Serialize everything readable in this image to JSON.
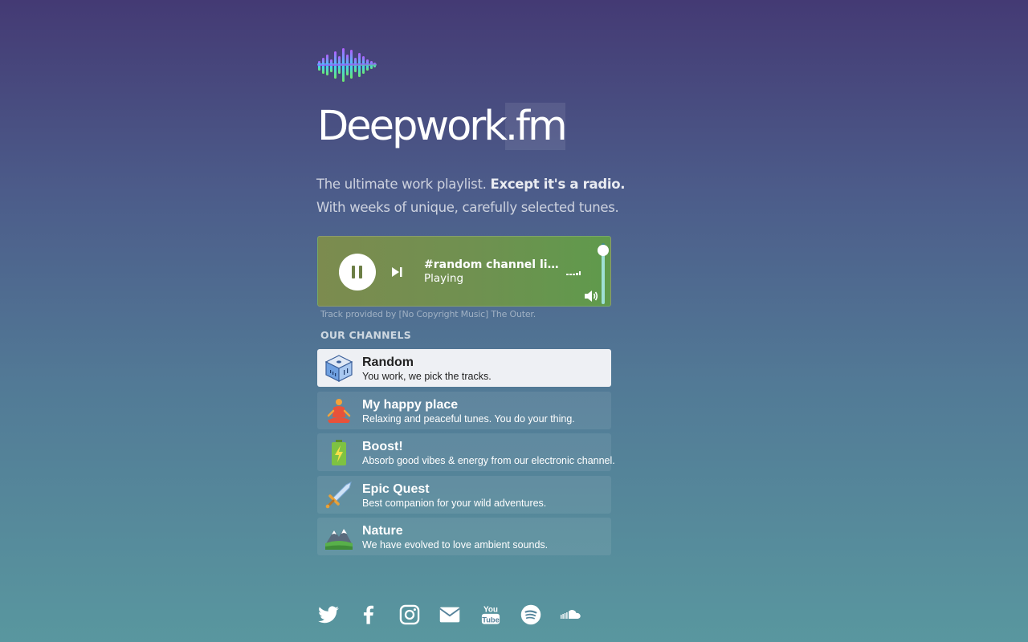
{
  "site": {
    "title_main": "Deepwork",
    "title_tld": ".fm",
    "tagline_plain": "The ultimate work playlist. ",
    "tagline_bold": "Except it's a radio.",
    "tagline_line2": "With weeks of unique, carefully selected tunes."
  },
  "player": {
    "track_title": "#random channel live…",
    "status": "Playing",
    "volume": 0.95,
    "credit": "Track provided by [No Copyright Music] The Outer."
  },
  "channels_title": "OUR CHANNELS",
  "channels": [
    {
      "name": "Random",
      "desc": "You work, we pick the tracks.",
      "icon": "dice-icon",
      "active": true
    },
    {
      "name": "My happy place",
      "desc": "Relaxing and peaceful tunes. You do your thing.",
      "icon": "meditation-icon",
      "active": false
    },
    {
      "name": "Boost!",
      "desc": "Absorb good vibes & energy from our electronic channel.",
      "icon": "battery-icon",
      "active": false
    },
    {
      "name": "Epic Quest",
      "desc": "Best companion for your wild adventures.",
      "icon": "sword-icon",
      "active": false
    },
    {
      "name": "Nature",
      "desc": "We have evolved to love ambient sounds.",
      "icon": "mountain-icon",
      "active": false
    }
  ],
  "social": [
    "twitter-icon",
    "facebook-icon",
    "instagram-icon",
    "mail-icon",
    "youtube-icon",
    "spotify-icon",
    "soundcloud-icon"
  ]
}
